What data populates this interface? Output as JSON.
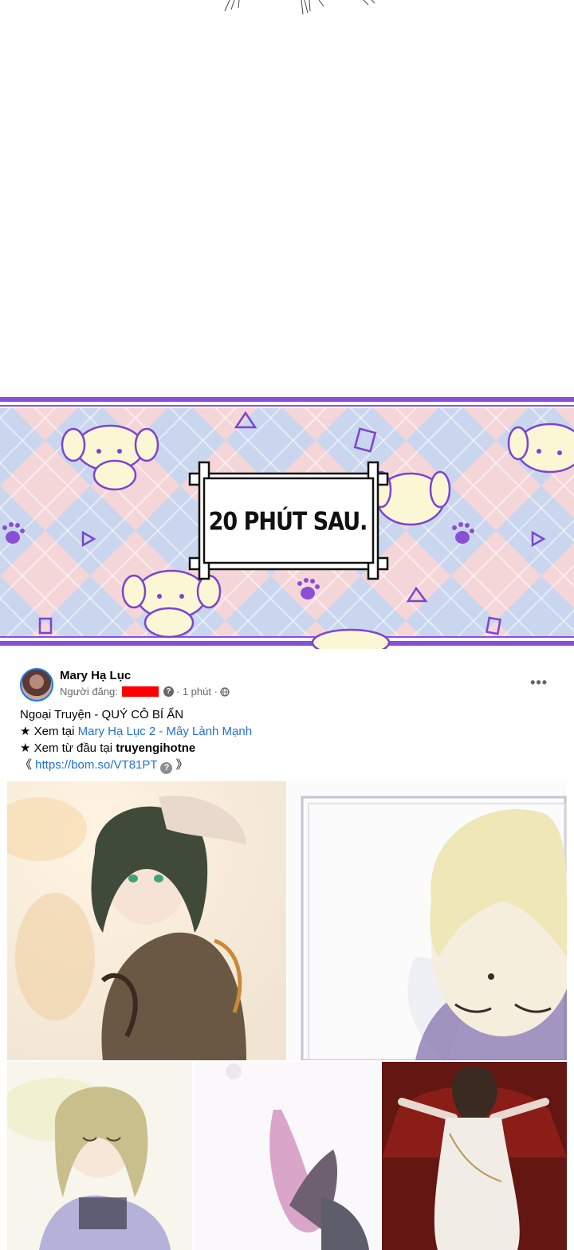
{
  "panel": {
    "caption": "20 PHÚT SAU."
  },
  "post": {
    "author": "Mary Hạ Lục",
    "poster_label": "Người đăng:",
    "time": "· 1 phút ·",
    "more_label": "•••",
    "lines": {
      "title": "Ngoại Truyện - QUÝ CÔ BÍ ẨN",
      "read_at_prefix": "★ Xem tại ",
      "read_at_link": "Mary Hạ Lục 2 - Mây Lành Mạnh",
      "from_start_prefix": "★ Xem từ đầu tại ",
      "from_start_site": "truyengihotne",
      "url_open": "《 ",
      "url": "https://bom.so/VT81PT",
      "url_close": " 》"
    },
    "photos_count": 5
  },
  "colors": {
    "banner_border": "#8a4fd8",
    "link": "#216fdb",
    "redaction": "#ff0000"
  }
}
